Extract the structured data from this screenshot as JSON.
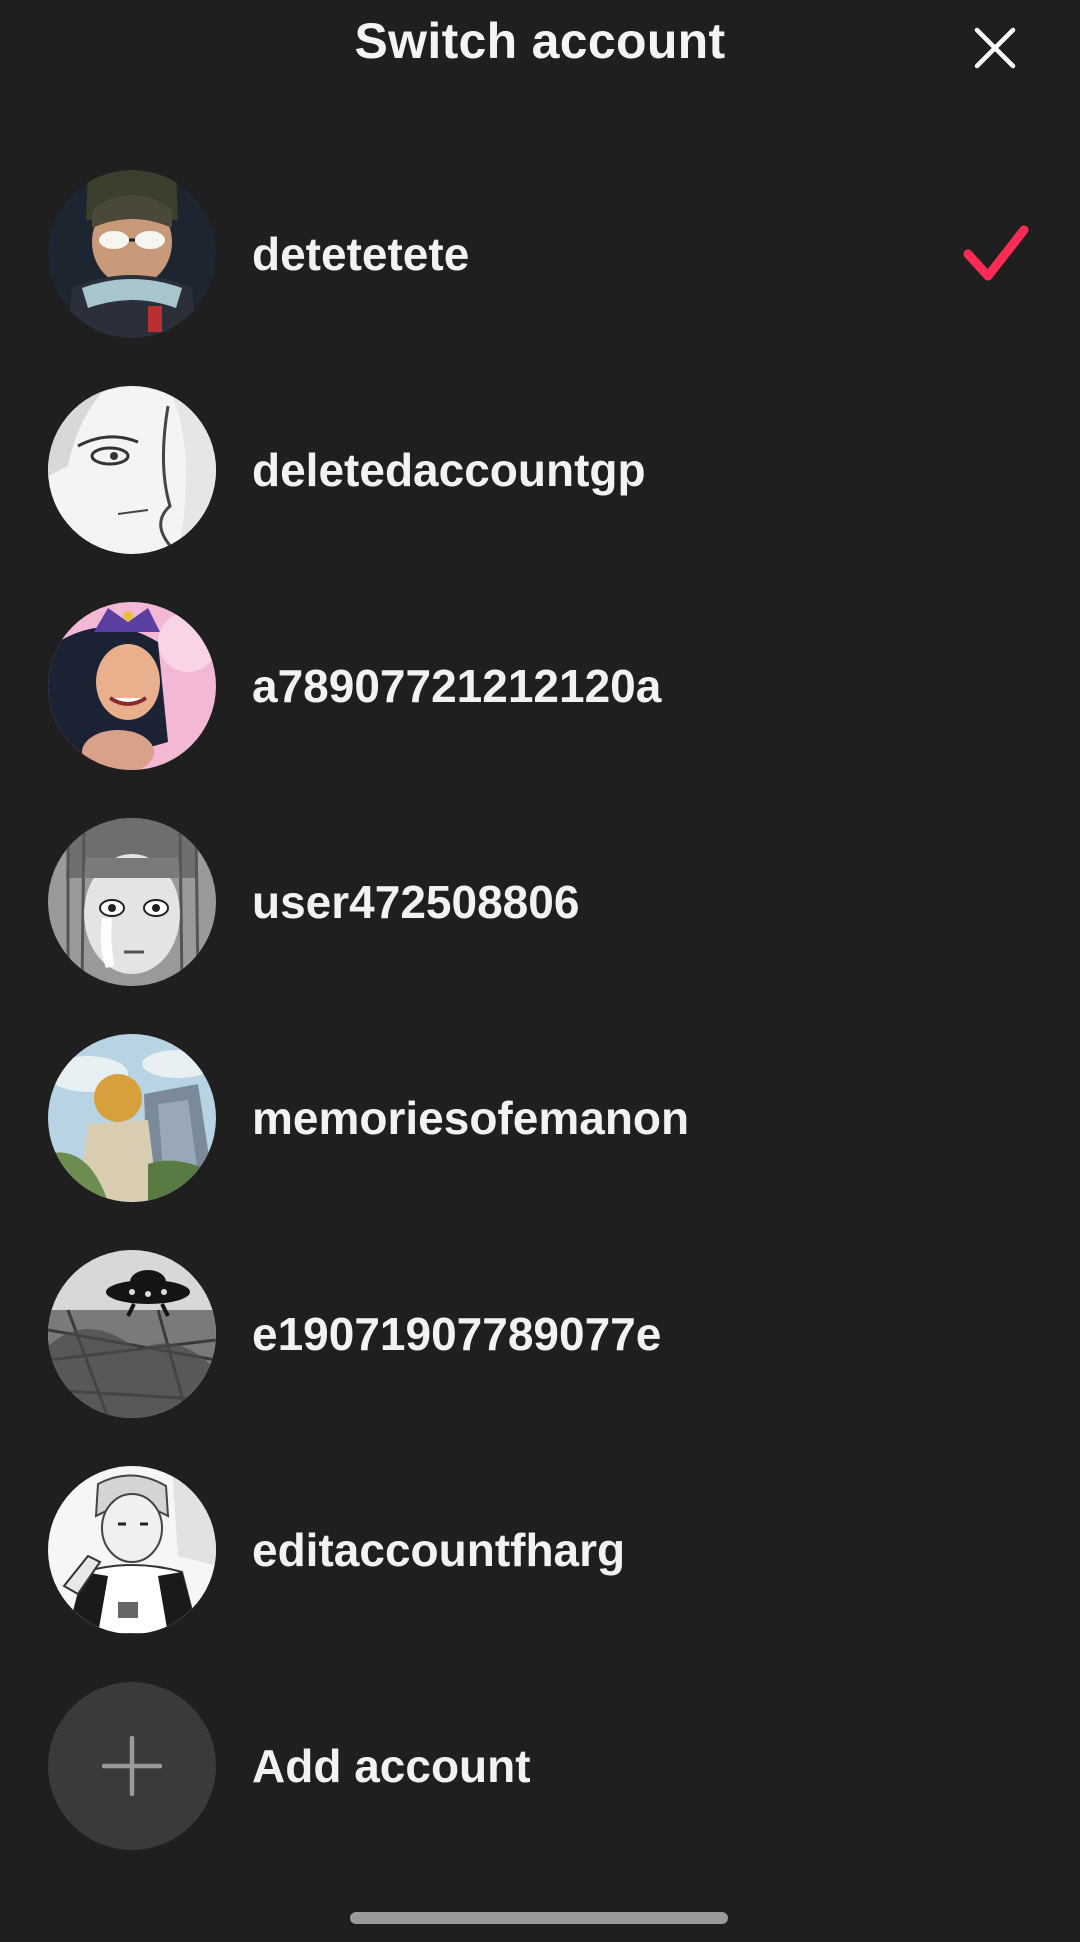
{
  "header": {
    "title": "Switch account",
    "close_icon": "close-icon"
  },
  "accounts": [
    {
      "username": "detetetete",
      "selected": true,
      "avatar": "anime-man-glasses-avatar"
    },
    {
      "username": "deletedaccountgp",
      "selected": false,
      "avatar": "manga-face-sketch-avatar"
    },
    {
      "username": "a78907721212120a",
      "selected": false,
      "avatar": "anime-woman-pink-avatar"
    },
    {
      "username": "user472508806",
      "selected": false,
      "avatar": "manga-girl-crying-avatar"
    },
    {
      "username": "memoriesofemanon",
      "selected": false,
      "avatar": "landscape-painting-avatar"
    },
    {
      "username": "e19071907789077e",
      "selected": false,
      "avatar": "ufo-sketch-avatar"
    },
    {
      "username": "editaccountfharg",
      "selected": false,
      "avatar": "manga-boy-sketch-avatar"
    }
  ],
  "add_account": {
    "label": "Add account",
    "icon": "plus-icon"
  },
  "colors": {
    "background": "#1f1f1f",
    "text": "#f2f2f2",
    "accent_check": "#fe2c55",
    "add_circle": "#3a3a3a"
  }
}
